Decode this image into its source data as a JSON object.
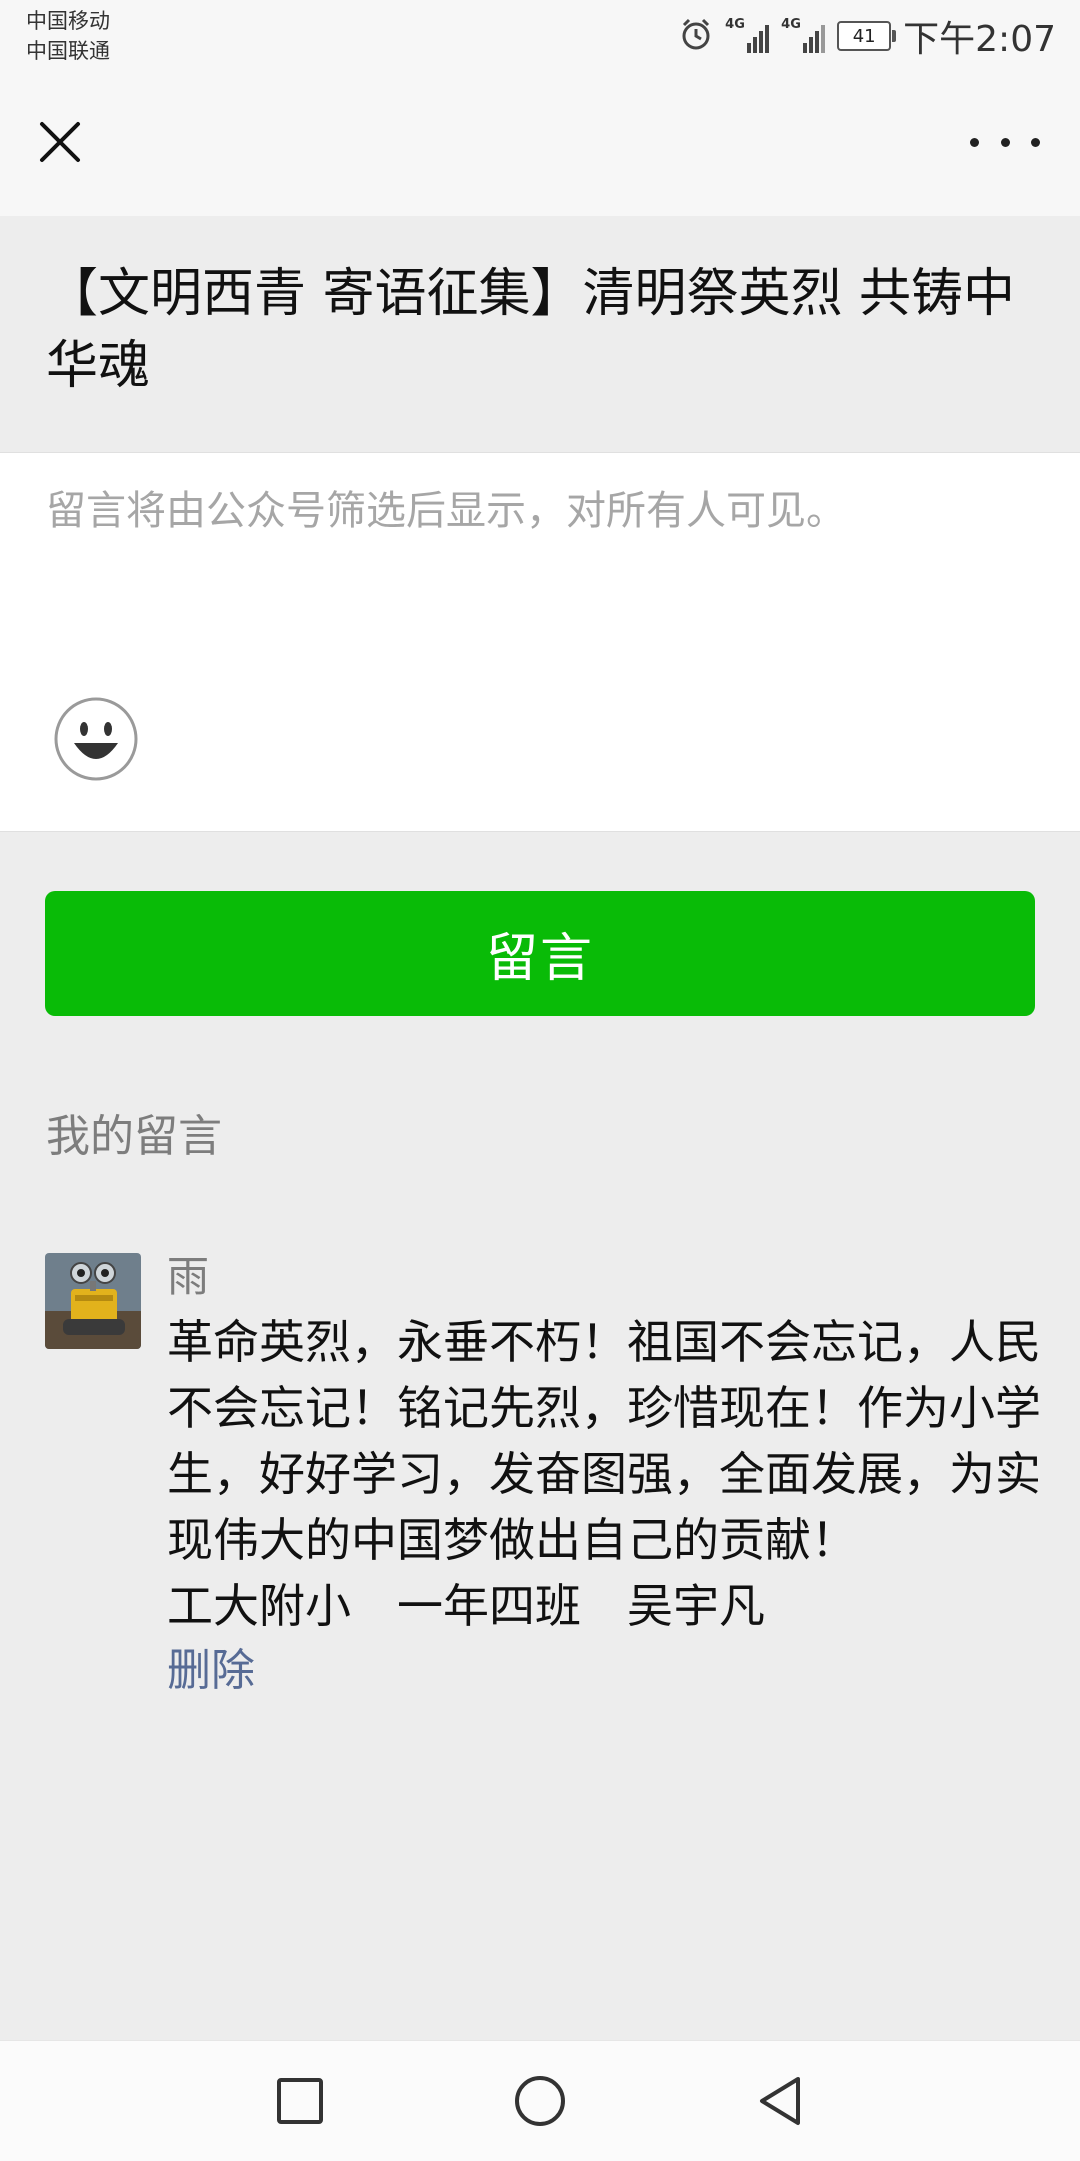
{
  "status_bar": {
    "carrier_1": "中国移动",
    "carrier_2": "中国联通",
    "network_1": "4G",
    "network_2": "4G",
    "battery": "41",
    "time": "下午2:07",
    "icons": [
      "alarm-icon",
      "signal-icon",
      "battery-icon"
    ]
  },
  "top_bar": {
    "close_icon": "close-icon",
    "more_icon": "more-icon"
  },
  "article": {
    "title": "【文明西青 寄语征集】清明祭英烈 共铸中华魂"
  },
  "comment_input": {
    "placeholder": "留言将由公众号筛选后显示，对所有人可见。",
    "emoji_icon": "emoji-icon"
  },
  "submit": {
    "label": "留言"
  },
  "my_comments": {
    "label": "我的留言",
    "items": [
      {
        "user": "雨",
        "text": "革命英烈，永垂不朽！祖国不会忘记，人民不会忘记！铭记先烈，珍惜现在！作为小学生，好好学习，发奋图强，全面发展，为实现伟大的中国梦做出自己的贡献！\n工大附小　一年四班　吴宇凡",
        "delete_label": "删除"
      }
    ]
  },
  "nav_bar": {
    "icons": [
      "recent-apps-icon",
      "home-icon",
      "back-icon"
    ]
  },
  "colors": {
    "accent_green": "#09bb07",
    "link_blue": "#576b95",
    "background": "#ededed"
  }
}
